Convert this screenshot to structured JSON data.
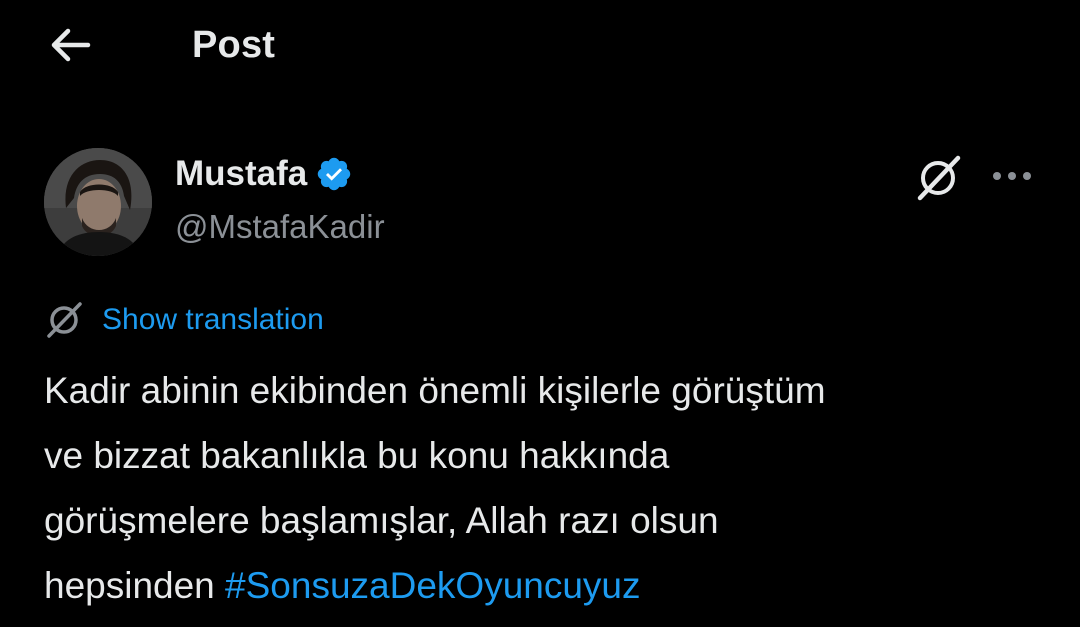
{
  "header": {
    "title": "Post",
    "back_icon": "arrow-left-icon"
  },
  "author": {
    "display_name": "Mustafa",
    "handle": "@MstafaKadir",
    "verified": true,
    "verified_color": "#1d9bf0"
  },
  "actions": {
    "grok_icon": "grok-icon",
    "more_icon": "more-horizontal-icon"
  },
  "translation": {
    "label": "Show translation",
    "icon": "translate-icon"
  },
  "tweet": {
    "lines": [
      "Kadir abinin ekibinden önemli kişilerle görüştüm",
      "ve bizzat bakanlıkla bu konu hakkında",
      "görüşmelere başlamışlar, Allah razı olsun"
    ],
    "last_line_text": "hepsinden ",
    "hashtag": "#SonsuzaDekOyuncuyuz"
  },
  "colors": {
    "background": "#000000",
    "text": "#e7e9ea",
    "secondary": "#8b9096",
    "accent": "#1d9bf0"
  }
}
